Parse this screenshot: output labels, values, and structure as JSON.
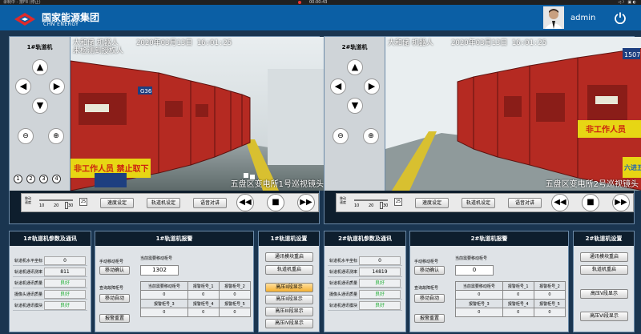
{
  "recorder": {
    "title": "录制中 - 按F8 (停止)",
    "time": "00:00:43",
    "right": "◁ 〉 ▣ ◐"
  },
  "header": {
    "company_cn": "国家能源集团",
    "company_en": "CHN ENERGY",
    "user": "admin"
  },
  "panels": [
    {
      "title": "1#轨道机",
      "cam_overlay_line1": "大和储   机器人",
      "cam_overlay_line2": "未检测到授权人",
      "cam_datetime": "2020年03月13日  16:01:25",
      "cam_bottom": "五盘区变电所1号巡视镜头",
      "presets": [
        "1",
        "2",
        "3",
        "4"
      ],
      "speed_label": "移动\n速度",
      "speed_ticks": [
        "10",
        "20",
        "30"
      ],
      "speed_value": "25",
      "speed_fraction": 0.8,
      "buttons": [
        "速度设定",
        "轨道机设定",
        "语音对讲"
      ],
      "cam_signs": [
        "G36",
        "非工作人员  禁止取下"
      ]
    },
    {
      "title": "2#轨道机",
      "cam_overlay_line1": "大和储   机器人",
      "cam_overlay_line2": "",
      "cam_datetime": "2020年03月13日  16:01:25",
      "cam_bottom": "五盘区变电所2号巡视镜头",
      "presets": [],
      "speed_label": "移动\n速度",
      "speed_ticks": [
        "10",
        "20",
        "30"
      ],
      "speed_value": "25",
      "speed_fraction": 0.8,
      "buttons": [
        "速度设定",
        "轨道机设定",
        "语音对讲"
      ],
      "cam_signs": [
        "1507",
        "非工作人员",
        "六进五"
      ]
    }
  ],
  "params1": {
    "title": "1#轨道机参数及通讯",
    "rows": [
      {
        "k": "轨道机水平坐标",
        "v": "0"
      },
      {
        "k": "轨道机通讯测率",
        "v": "811"
      },
      {
        "k": "轨道机通讯质量",
        "v": "良好"
      },
      {
        "k": "摄像头通讯质量",
        "v": "良好"
      },
      {
        "k": "轨道机通讯模块",
        "v": "良好"
      }
    ]
  },
  "alarm1": {
    "title": "1#轨道机报警",
    "move_to_label": "手动移动柜号",
    "current_cab_label": "当前需要移动柜号",
    "current_cab_value": "1302",
    "move_confirm": "移动确认",
    "query_label": "查询故障柜号",
    "auto_move": "移动自动",
    "alarm_reset": "报警重置",
    "grid": [
      [
        "当前需要移动柜号",
        "报警柜号_1",
        "报警柜号_2"
      ],
      [
        "0",
        "0",
        "0"
      ],
      [
        "报警柜号_3",
        "报警柜号_4",
        "报警柜号_5"
      ],
      [
        "0",
        "0",
        "0"
      ]
    ]
  },
  "settings1": {
    "title": "1#轨道机设置",
    "buttons": [
      "通讯模块重启",
      "轨道机重启",
      "高压II段显示",
      "高压II段显示",
      "高压III段显示",
      "高压IV段显示"
    ]
  },
  "params2": {
    "title": "2#轨道机参数及通讯",
    "rows": [
      {
        "k": "轨道机水平坐标",
        "v": "0"
      },
      {
        "k": "轨道机通讯测率",
        "v": "14819"
      },
      {
        "k": "轨道机通讯质量",
        "v": "良好"
      },
      {
        "k": "摄像头通讯质量",
        "v": "良好"
      },
      {
        "k": "轨道机通讯模块",
        "v": "良好"
      }
    ]
  },
  "alarm2": {
    "title": "2#轨道机报警",
    "move_to_label": "手动移动柜号",
    "current_cab_label": "当前需要移动柜号",
    "current_cab_value": "0",
    "move_confirm": "移动确认",
    "query_label": "查询故障柜号",
    "auto_move": "移动自动",
    "alarm_reset": "报警重置",
    "grid": [
      [
        "当前需要移动柜号",
        "报警柜号_1",
        "报警柜号_2"
      ],
      [
        "0",
        "0",
        "0"
      ],
      [
        "报警柜号_3",
        "报警柜号_4",
        "报警柜号_5"
      ],
      [
        "0",
        "0",
        "0"
      ]
    ]
  },
  "settings2": {
    "title": "2#轨道机设置",
    "buttons": [
      "通讯模块重启",
      "轨道机重启",
      "高压V段显示",
      "高压VI段显示"
    ]
  },
  "colors": {
    "accent": "#0b5fa5",
    "ok": "#26b03a",
    "highlight": "#f5b030"
  }
}
